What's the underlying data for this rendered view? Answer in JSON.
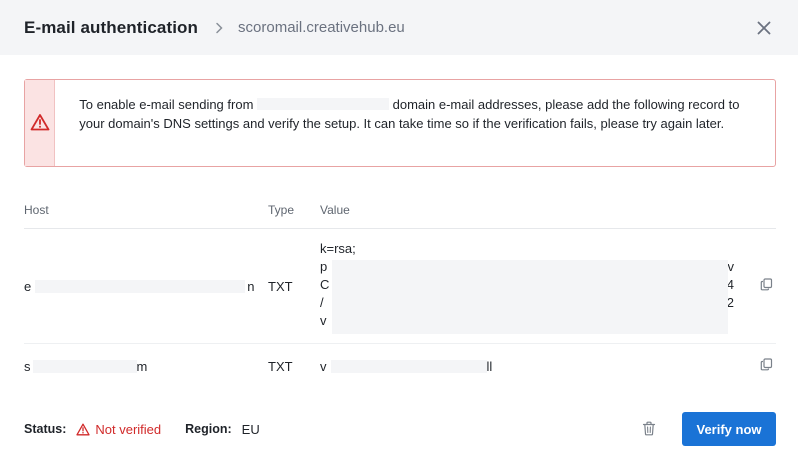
{
  "header": {
    "title": "E-mail authentication",
    "subtitle": "scoromail.creativehub.eu",
    "close_icon": "close-icon",
    "separator_icon": "chevron-right-icon"
  },
  "alert": {
    "icon": "warning-icon",
    "text_before": "To enable e-mail sending from ",
    "text_after": " domain e-mail addresses, please add the following record to your domain's DNS settings and verify the setup. It can take time so if the verification fails, please try again later."
  },
  "table": {
    "headers": {
      "host": "Host",
      "type": "Type",
      "value": "Value"
    },
    "rows": [
      {
        "host_start": "e",
        "host_end": "n",
        "type": "TXT",
        "value_lines": [
          "k=rsa;",
          "p",
          "C",
          "/",
          "v"
        ],
        "value_line_ends": [
          "",
          "v",
          "4",
          "2",
          ""
        ],
        "copy_icon": "copy-icon"
      },
      {
        "host_start": "s",
        "host_end": "m",
        "type": "TXT",
        "value_start": "v",
        "value_end": "ll",
        "copy_icon": "copy-icon"
      }
    ]
  },
  "footer": {
    "status_label": "Status:",
    "status_value": "Not verified",
    "status_icon": "warning-icon",
    "region_label": "Region:",
    "region_value": "EU",
    "delete_icon": "trash-icon",
    "verify_button": "Verify now"
  },
  "colors": {
    "accent": "#1a73d6",
    "error": "#d12a2a",
    "alert_bg": "#fbe3e3",
    "alert_border": "#e8a3a3",
    "header_bg": "#f4f5f7"
  }
}
